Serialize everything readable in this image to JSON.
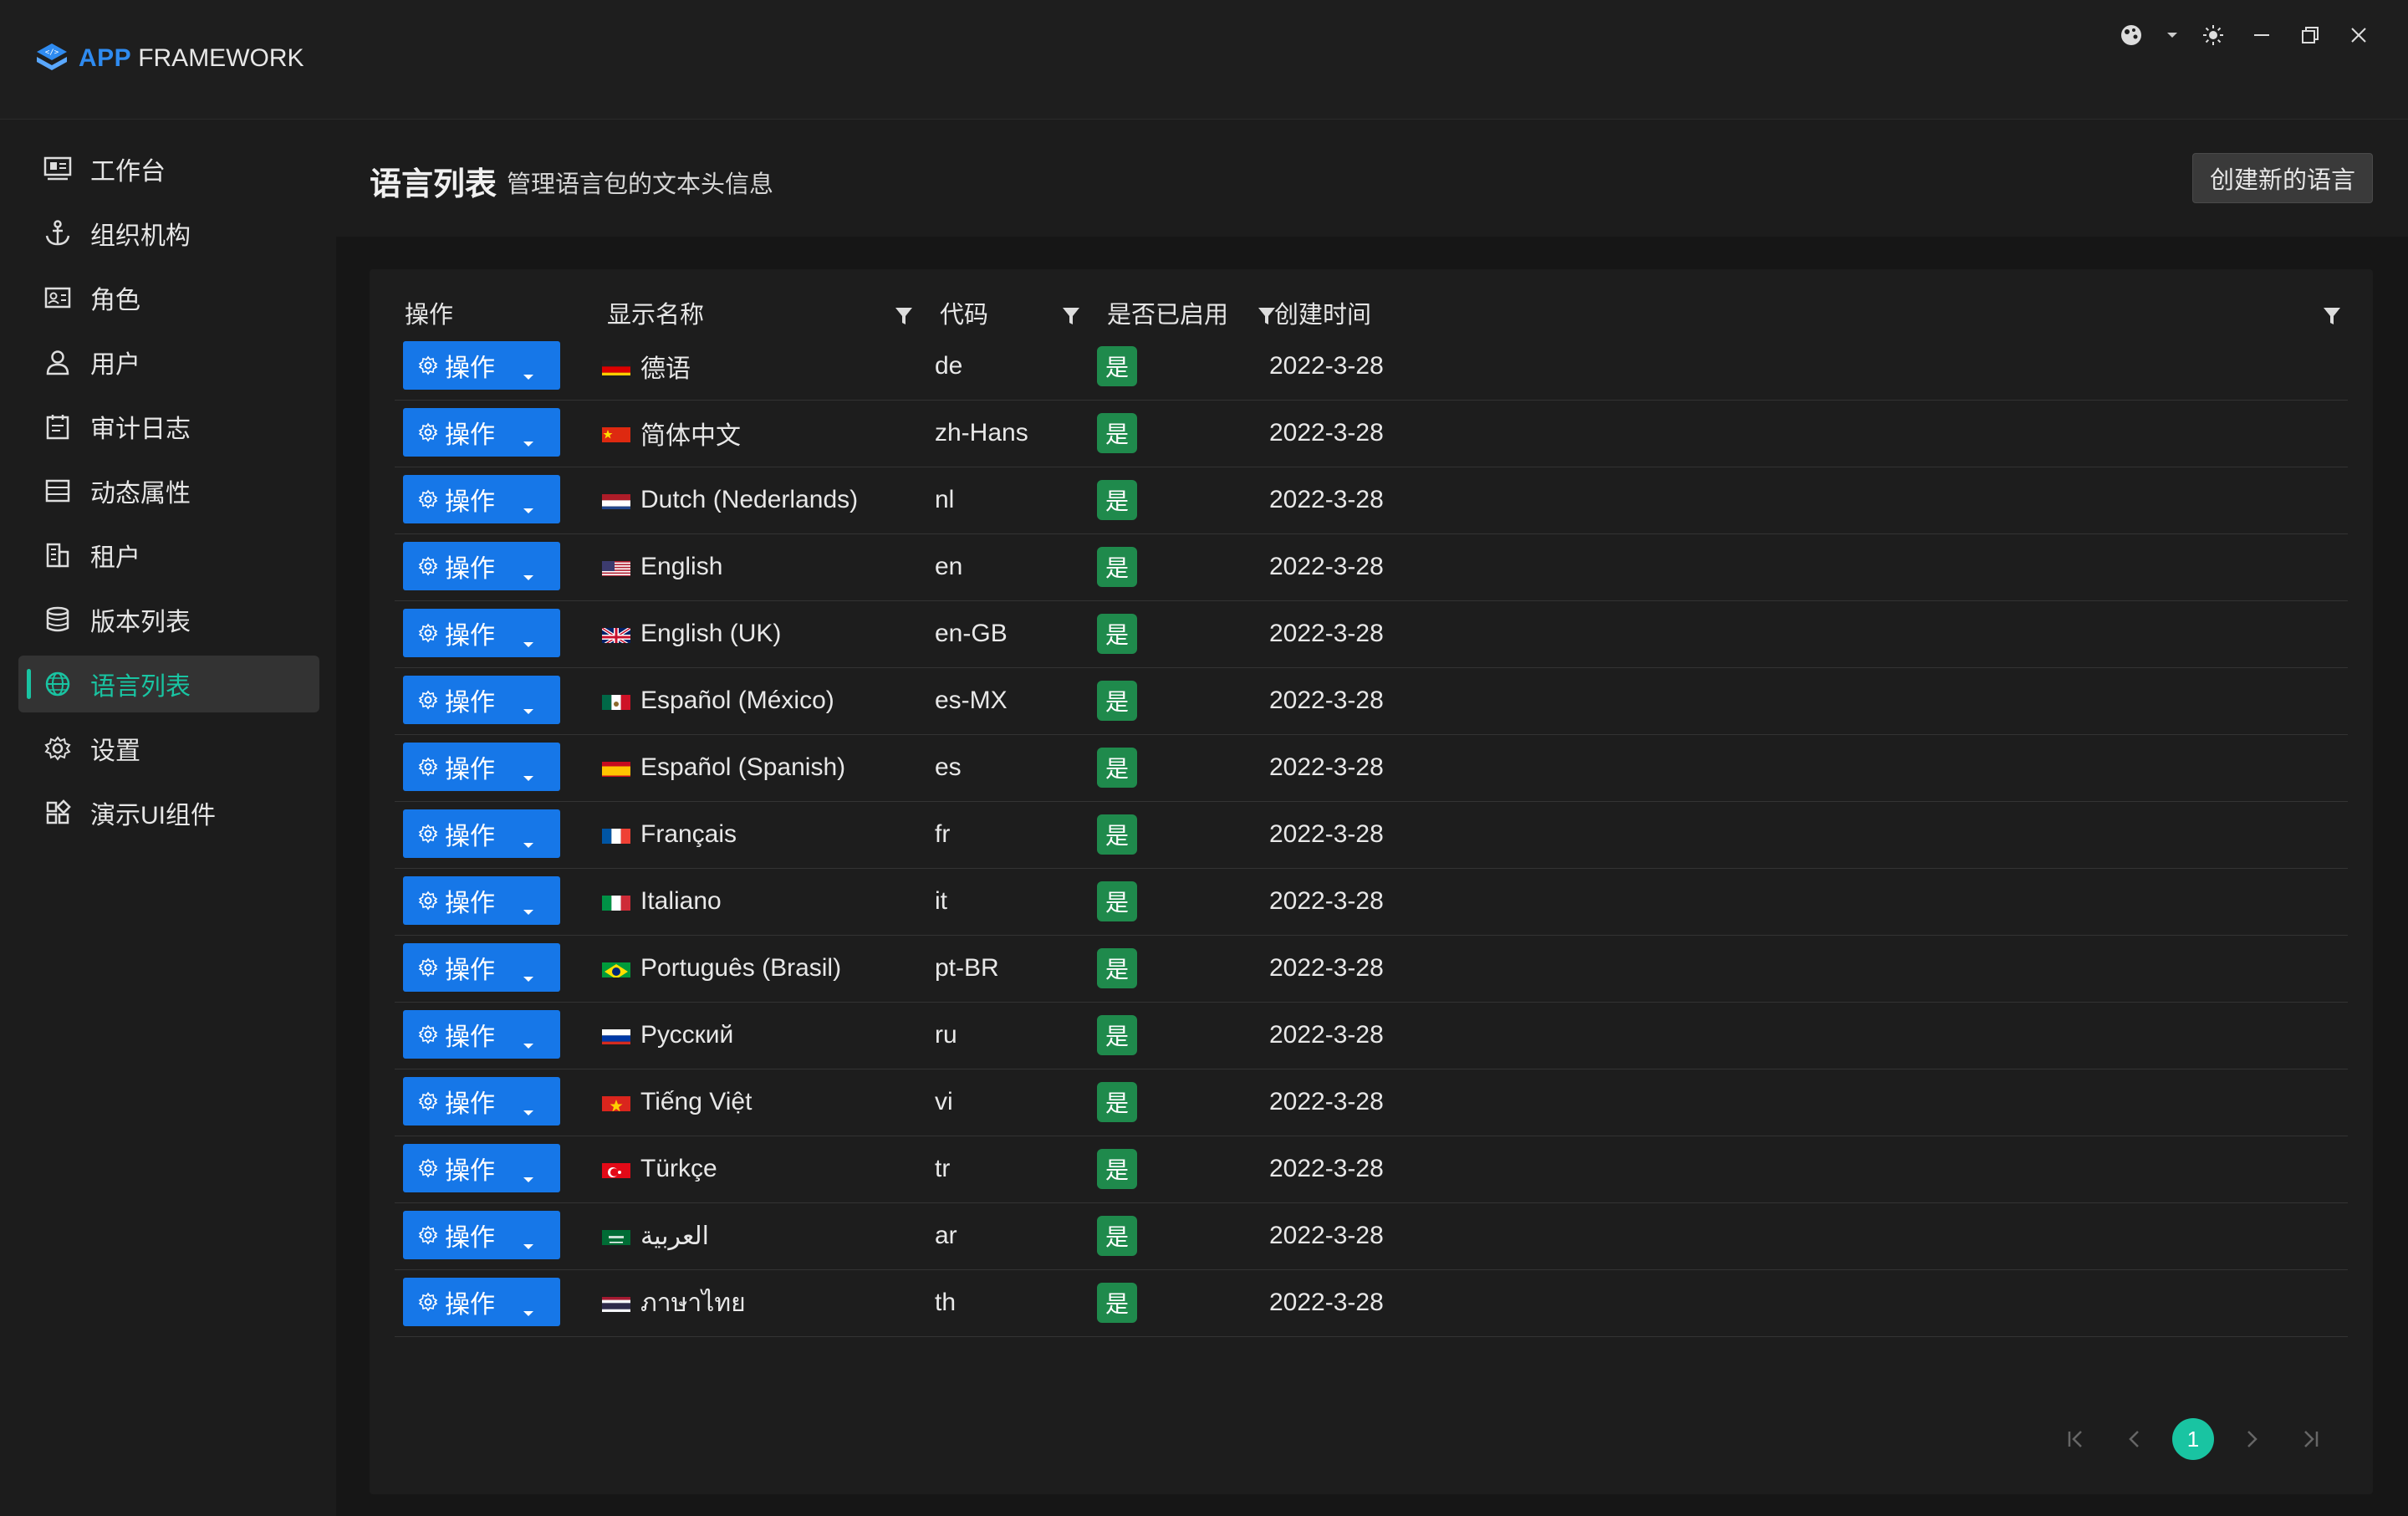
{
  "brand": {
    "app": "APP",
    "framework": "FRAMEWORK"
  },
  "window_controls": [
    "theme-icon",
    "chevron-down-icon",
    "sun-icon",
    "minimize-icon",
    "restore-icon",
    "close-icon"
  ],
  "sidebar": {
    "items": [
      {
        "label": "工作台",
        "icon": "dashboard-icon"
      },
      {
        "label": "组织机构",
        "icon": "anchor-icon"
      },
      {
        "label": "角色",
        "icon": "id-card-icon"
      },
      {
        "label": "用户",
        "icon": "user-icon"
      },
      {
        "label": "审计日志",
        "icon": "calendar-icon"
      },
      {
        "label": "动态属性",
        "icon": "list-icon"
      },
      {
        "label": "租户",
        "icon": "building-icon"
      },
      {
        "label": "版本列表",
        "icon": "database-icon"
      },
      {
        "label": "语言列表",
        "icon": "globe-icon",
        "active": true
      },
      {
        "label": "设置",
        "icon": "gear-icon"
      },
      {
        "label": "演示UI组件",
        "icon": "components-icon"
      }
    ],
    "active_color": "#19c4a2"
  },
  "header": {
    "title": "语言列表",
    "subtitle": "管理语言包的文本头信息",
    "create_button": "创建新的语言"
  },
  "table": {
    "columns": {
      "action": "操作",
      "display_name": "显示名称",
      "code": "代码",
      "enabled": "是否已启用",
      "created": "创建时间"
    },
    "action_label": "操作",
    "rows": [
      {
        "flag": "de",
        "name": "德语",
        "code": "de",
        "enabled": "是",
        "created": "2022-3-28"
      },
      {
        "flag": "cn",
        "name": "简体中文",
        "code": "zh-Hans",
        "enabled": "是",
        "created": "2022-3-28"
      },
      {
        "flag": "nl",
        "name": "Dutch (Nederlands)",
        "code": "nl",
        "enabled": "是",
        "created": "2022-3-28"
      },
      {
        "flag": "us",
        "name": "English",
        "code": "en",
        "enabled": "是",
        "created": "2022-3-28"
      },
      {
        "flag": "gb",
        "name": "English (UK)",
        "code": "en-GB",
        "enabled": "是",
        "created": "2022-3-28"
      },
      {
        "flag": "mx",
        "name": "Español (México)",
        "code": "es-MX",
        "enabled": "是",
        "created": "2022-3-28"
      },
      {
        "flag": "es",
        "name": "Español (Spanish)",
        "code": "es",
        "enabled": "是",
        "created": "2022-3-28"
      },
      {
        "flag": "fr",
        "name": "Français",
        "code": "fr",
        "enabled": "是",
        "created": "2022-3-28"
      },
      {
        "flag": "it",
        "name": "Italiano",
        "code": "it",
        "enabled": "是",
        "created": "2022-3-28"
      },
      {
        "flag": "br",
        "name": "Português (Brasil)",
        "code": "pt-BR",
        "enabled": "是",
        "created": "2022-3-28"
      },
      {
        "flag": "ru",
        "name": "Русский",
        "code": "ru",
        "enabled": "是",
        "created": "2022-3-28"
      },
      {
        "flag": "vn",
        "name": "Tiếng Việt",
        "code": "vi",
        "enabled": "是",
        "created": "2022-3-28"
      },
      {
        "flag": "tr",
        "name": "Türkçe",
        "code": "tr",
        "enabled": "是",
        "created": "2022-3-28"
      },
      {
        "flag": "sa",
        "name": "العربية",
        "code": "ar",
        "enabled": "是",
        "created": "2022-3-28"
      },
      {
        "flag": "th",
        "name": "ภาษาไทย",
        "code": "th",
        "enabled": "是",
        "created": "2022-3-28"
      }
    ]
  },
  "pagination": {
    "current_page": "1"
  },
  "colors": {
    "primary_button": "#1677e8",
    "enabled_badge": "#1f8a4c",
    "accent": "#19c4a2"
  }
}
